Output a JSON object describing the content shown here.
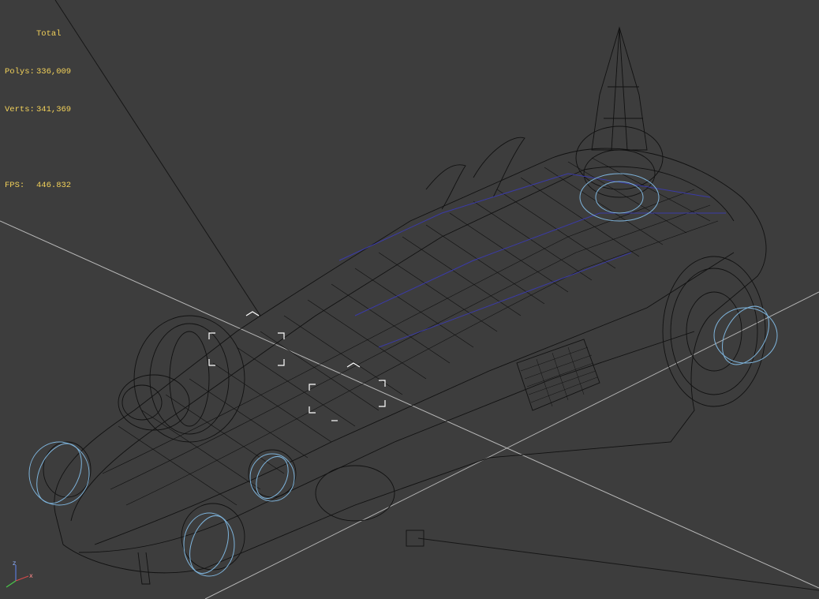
{
  "stats": {
    "header": "Total",
    "polys_label": "Polys:",
    "polys_value": "336,009",
    "verts_label": "Verts:",
    "verts_value": "341,369",
    "fps_label": "FPS:",
    "fps_value": "446.832"
  },
  "viewport": {
    "background_color": "#3d3d3d",
    "wireframe_color": "#111111",
    "accent_wire_color": "#3a3aa8",
    "helper_color": "#7eb4dc",
    "grid_line_color": "#b8b8b8"
  },
  "axis_gizmo": {
    "z_label": "z",
    "x_label": "x"
  }
}
